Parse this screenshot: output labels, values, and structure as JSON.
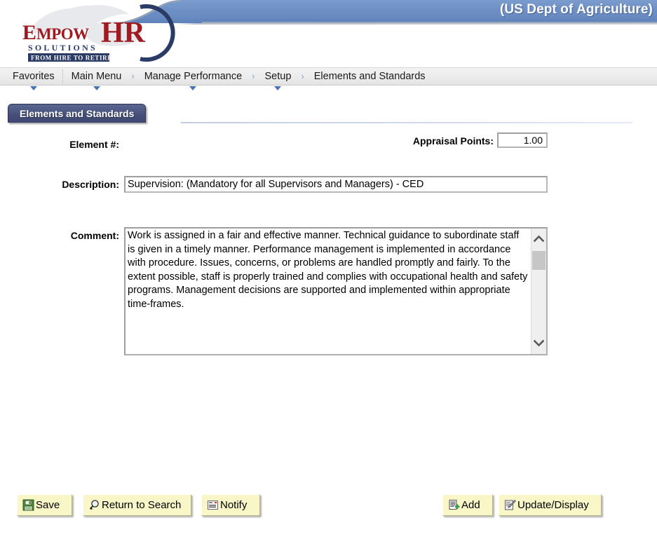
{
  "header": {
    "agency": "(US Dept of Agriculture)",
    "logo": {
      "word_empow": "EMPOW",
      "word_hr": "HR",
      "word_solutions": "S O L U T I O N S",
      "tagline": "FROM HIRE TO RETIRE",
      "alt": "EmpowHR Solutions logo with eagle"
    }
  },
  "breadcrumb": {
    "items": [
      {
        "label": "Favorites",
        "has_caret": true,
        "separator_after": true,
        "arrow_after": false
      },
      {
        "label": "Main Menu",
        "has_caret": true,
        "separator_after": false,
        "arrow_after": true
      },
      {
        "label": "Manage Performance",
        "has_caret": true,
        "separator_after": false,
        "arrow_after": true
      },
      {
        "label": "Setup",
        "has_caret": true,
        "separator_after": false,
        "arrow_after": true
      },
      {
        "label": "Elements and Standards",
        "has_caret": false,
        "separator_after": false,
        "arrow_after": false
      }
    ],
    "arrow_glyph": "›"
  },
  "tab": {
    "label": "Elements and Standards"
  },
  "form": {
    "element_label": "Element #:",
    "element_value": "",
    "appraisal_points_label": "Appraisal Points:",
    "appraisal_points_value": "1.00",
    "description_label": "Description:",
    "description_value": "Supervision: (Mandatory for all Supervisors and Managers) - CED",
    "comment_label": "Comment:",
    "comment_value": "Work is assigned in a fair and effective manner. Technical guidance to subordinate staff is given in a timely manner. Performance management is implemented in accordance with procedure. Issues, concerns, or problems are handled promptly and fairly. To the extent possible, staff is properly trained and complies with occupational health and safety programs. Management decisions are supported and implemented within appropriate time-frames."
  },
  "buttons": {
    "save": {
      "label": "Save",
      "icon": "floppy-disk-icon"
    },
    "return_to_search": {
      "label": "Return to Search",
      "icon": "magnifier-icon"
    },
    "notify": {
      "label": "Notify",
      "icon": "envelope-note-icon"
    },
    "add": {
      "label": "Add",
      "icon": "document-plus-icon"
    },
    "update_display": {
      "label": "Update/Display",
      "icon": "pencil-document-icon"
    }
  },
  "colors": {
    "header_blue": "#6e8fc4",
    "tab_navy": "#4c5782",
    "button_yellow": "#f9f6c7",
    "crumb_caret_blue": "#4773b8",
    "logo_red": "#9e1b22",
    "logo_navy": "#2a3b66"
  }
}
